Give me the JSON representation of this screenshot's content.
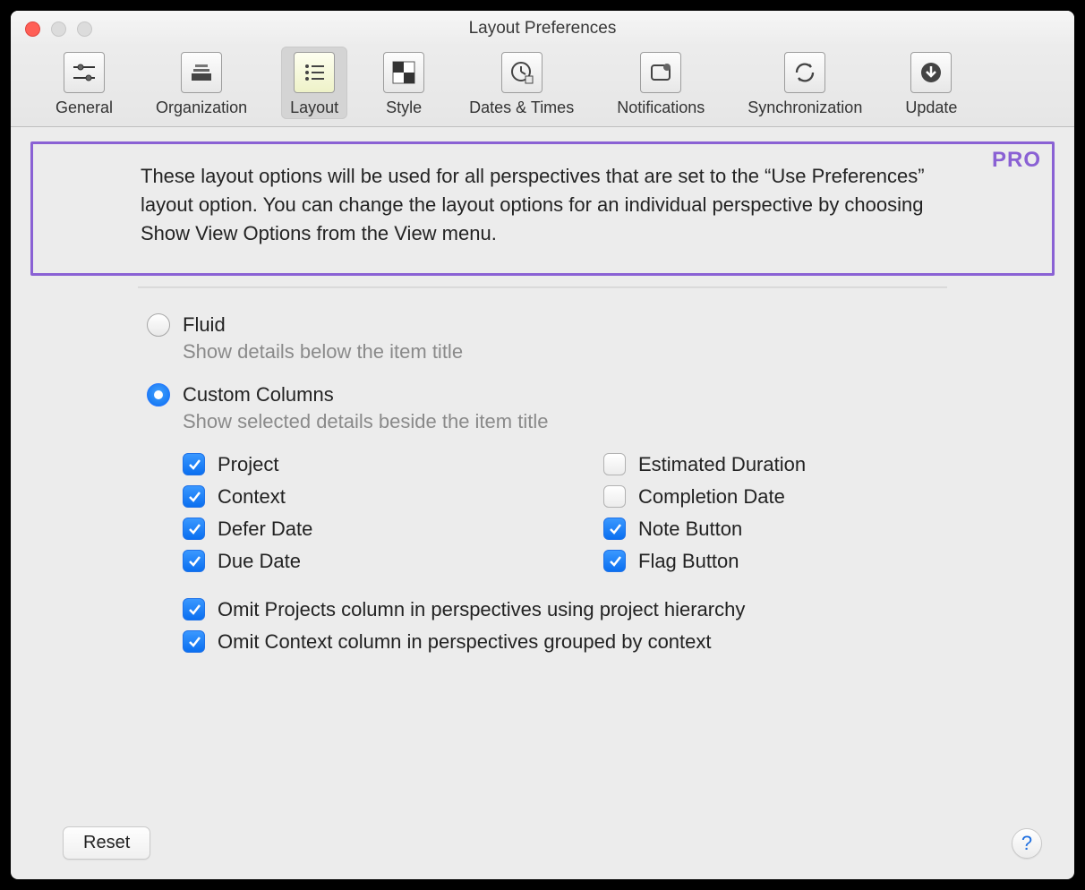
{
  "window": {
    "title": "Layout Preferences"
  },
  "toolbar": {
    "items": [
      {
        "label": "General"
      },
      {
        "label": "Organization"
      },
      {
        "label": "Layout"
      },
      {
        "label": "Style"
      },
      {
        "label": "Dates & Times"
      },
      {
        "label": "Notifications"
      },
      {
        "label": "Synchronization"
      },
      {
        "label": "Update"
      }
    ],
    "selected_index": 2
  },
  "pro": {
    "label": "PRO",
    "description": "These layout options will be used for all perspectives that are set to the “Use Preferences” layout option. You can change the layout options for an individual perspective by choosing Show View Options from the View menu."
  },
  "layout": {
    "fluid_label": "Fluid",
    "fluid_desc": "Show details below the item title",
    "custom_label": "Custom Columns",
    "custom_desc": "Show selected details beside the item title",
    "selected": "custom"
  },
  "columns": {
    "left": [
      {
        "label": "Project",
        "checked": true
      },
      {
        "label": "Context",
        "checked": true
      },
      {
        "label": "Defer Date",
        "checked": true
      },
      {
        "label": "Due Date",
        "checked": true
      }
    ],
    "right": [
      {
        "label": "Estimated Duration",
        "checked": false
      },
      {
        "label": "Completion Date",
        "checked": false
      },
      {
        "label": "Note Button",
        "checked": true
      },
      {
        "label": "Flag Button",
        "checked": true
      }
    ]
  },
  "omits": [
    {
      "label": "Omit Projects column in perspectives using project hierarchy",
      "checked": true
    },
    {
      "label": "Omit Context column in perspectives grouped by context",
      "checked": true
    }
  ],
  "footer": {
    "reset": "Reset",
    "help": "?"
  }
}
